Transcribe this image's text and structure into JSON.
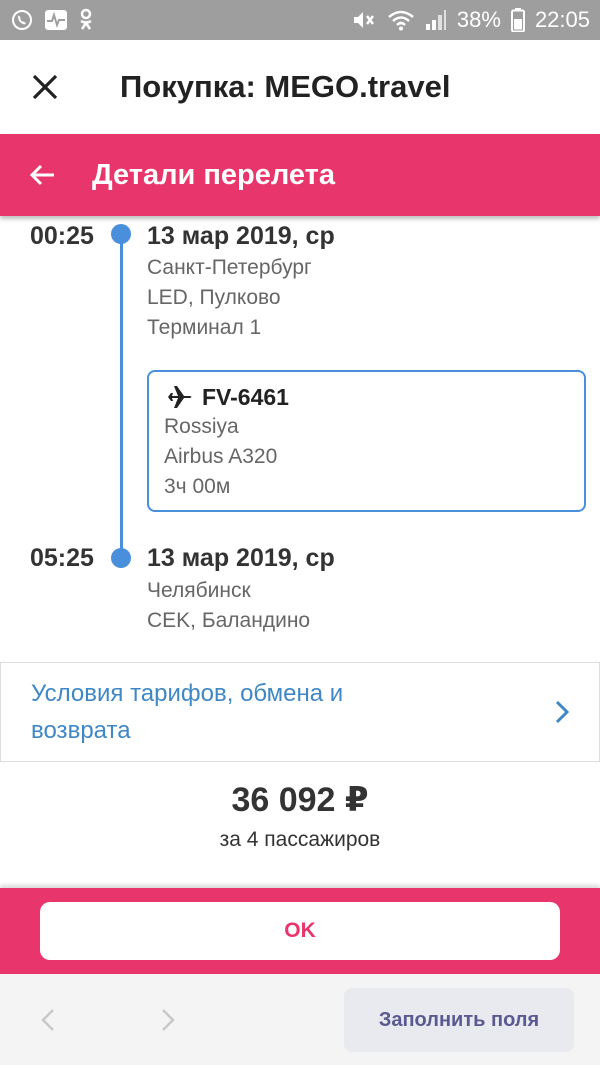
{
  "status_bar": {
    "battery": "38%",
    "time": "22:05",
    "icons_left": [
      "viber-icon",
      "activity-icon",
      "odnoklassniki-icon"
    ],
    "icons_right": [
      "mute-icon",
      "wifi-icon",
      "signal-icon",
      "battery-icon"
    ]
  },
  "titlebar": {
    "title": "Покупка: MEGO.travel"
  },
  "subheader": {
    "title": "Детали перелета"
  },
  "departure": {
    "time": "00:25",
    "date": "13 мар 2019, ср",
    "city": "Санкт-Петербург",
    "airport": "LED, Пулково",
    "terminal": "Терминал 1"
  },
  "flight": {
    "number": "FV-6461",
    "airline": "Rossiya",
    "aircraft": "Airbus A320",
    "duration": "3ч 00м"
  },
  "arrival": {
    "time": "05:25",
    "date": "13 мар 2019, ср",
    "city": "Челябинск",
    "airport": "CEK, Баландино"
  },
  "tariff": {
    "label": "Условия тарифов, обмена и возврата"
  },
  "price": {
    "amount": "36 092 ₽",
    "note": "за 4 пассажиров"
  },
  "ok_button": {
    "label": "OK"
  },
  "bottom": {
    "fill_label": "Заполнить поля"
  },
  "colors": {
    "accent": "#e8356b",
    "timeline": "#4a8fdb",
    "link": "#3f88c5"
  }
}
